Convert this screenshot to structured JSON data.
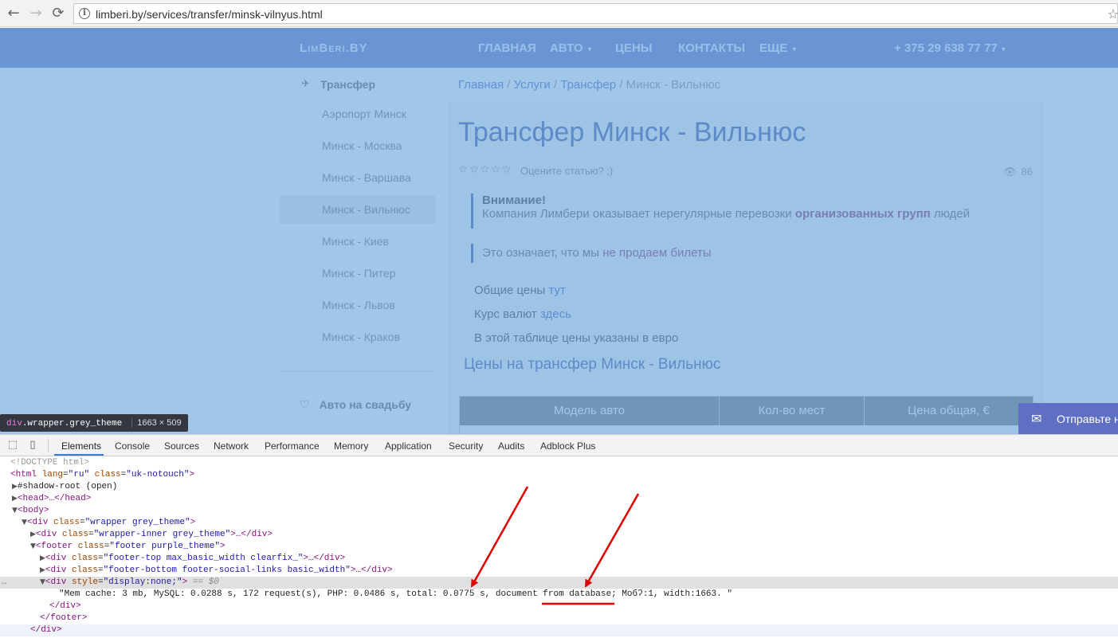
{
  "browser": {
    "url": "limberi.by/services/transfer/minsk-vilnyus.html",
    "back_glyph": "←",
    "forward_glyph": "→",
    "reload_glyph": "⟳",
    "info_glyph": "i",
    "star_glyph": "☆"
  },
  "site": {
    "logo": "LimBeri.BY",
    "menu": [
      "ГЛАВНАЯ",
      "АВТО",
      "ЦЕНЫ",
      "КОНТАКТЫ",
      "ЕЩЕ"
    ],
    "chevron_glyph": "▾",
    "phone": "+ 375 29 638 77 77"
  },
  "sidebar": {
    "title": "Трансфер",
    "title_icon_glyph": "✈",
    "items": [
      "Аэропорт Минск",
      "Минск - Москва",
      "Минск - Варшава",
      "Минск - Вильнюс",
      "Минск - Киев",
      "Минск - Питер",
      "Минск - Львов",
      "Минск - Краков"
    ],
    "wedding": "Авто на свадьбу",
    "wedding_icon_glyph": "♡"
  },
  "breadcrumb": {
    "items": [
      "Главная",
      "Услуги",
      "Трансфер"
    ],
    "current": "Минск - Вильнюс",
    "separator": "/"
  },
  "article": {
    "title": "Трансфер Минск - Вильнюс",
    "rating_stars": "☆☆☆☆☆",
    "rating_prompt": "Оцените статью? ;)",
    "views": "86",
    "eye_glyph": "👁",
    "note1_title": "Внимание!",
    "note1_text": "Компания Лимбери оказывает нерегулярные перевозки",
    "note1_highlight": "организованных групп",
    "note1_end": "людей",
    "note2_text": "Это означает, что мы",
    "note2_highlight": "не продаем билеты",
    "p1_text": "Общие цены",
    "p1_link": "тут",
    "p2_text": "Курс валют",
    "p2_link": "здесь",
    "p3_text": "В этой таблице цены указаны в евро",
    "subtitle": "Цены на трансфер Минск - Вильнюс",
    "table_headers": [
      "Модель авто",
      "Кол-во мест",
      "Цена общая, €"
    ]
  },
  "feedback": {
    "label": "Отправьте н",
    "icon_glyph": "✉"
  },
  "inspect_tooltip": {
    "tag": "div",
    "cls": ".wrapper.grey_theme",
    "size": "1663 × 509"
  },
  "devtools": {
    "tabs": [
      "Elements",
      "Console",
      "Sources",
      "Network",
      "Performance",
      "Memory",
      "Application",
      "Security",
      "Audits",
      "Adblock Plus"
    ],
    "inspect_glyph": "⬚",
    "device_glyph": "▯",
    "lines": {
      "doctype": "<!DOCTYPE html>",
      "html_open": "<html",
      "html_lang_attr": "lang",
      "html_lang_val": "\"ru\"",
      "html_class_attr": "class",
      "html_class_val": "\"uk-notouch\"",
      "shadow": "#shadow-root (open)",
      "head": "<head>…</head>",
      "body": "<body>",
      "wrapper_open": "<div",
      "wrapper_class_val": "\"wrapper grey_theme\"",
      "inner_class_val": "\"wrapper-inner grey_theme\"",
      "footer_tag": "<footer",
      "footer_class_val": "\"footer purple_theme\"",
      "ft_class_val": "\"footer-top max_basic_width clearfix_\"",
      "fb_class_val": "\"footer-bottom footer-social-links basic_width\"",
      "style_attr": "style",
      "style_val": "\"display:none;\"",
      "dollar": "== $0",
      "text_node": "\"Mem cache: 3 mb, MySQL: 0.0288 s, 172 request(s), PHP: 0.0486 s, total: 0.0775 s, document from database; Мобʔ:1, width:1663. \"",
      "div_close": "</div>",
      "footer_close": "</footer>",
      "ellipsis_close_div": ">…</div>",
      "gt": ">",
      "more": "…"
    }
  },
  "colors": {
    "header_bg": "#5f70c4",
    "overlay": "#6fa8dc",
    "arrow": "#e00000",
    "tag": "#881280",
    "attr": "#994500",
    "value": "#1a1aa6"
  }
}
